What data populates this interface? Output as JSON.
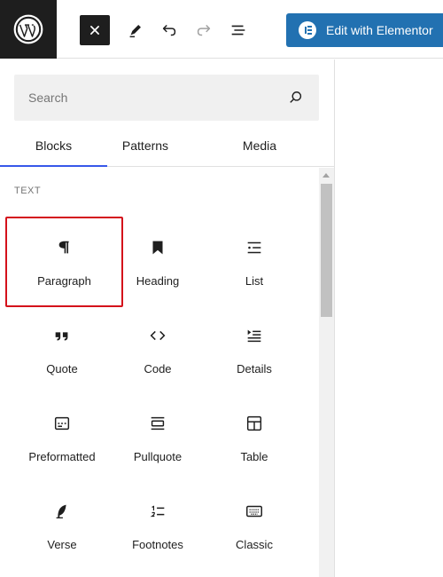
{
  "toolbar": {
    "wordpress_logo": "wordpress-logo",
    "close_icon": "close-icon",
    "tools_icon": "pencil-icon",
    "undo_icon": "undo-icon",
    "redo_icon": "redo-icon",
    "outline_icon": "list-view-icon",
    "elementor_label": "Edit with Elementor"
  },
  "inserter": {
    "search": {
      "placeholder": "Search",
      "value": ""
    },
    "tabs": [
      {
        "label": "Blocks",
        "active": true
      },
      {
        "label": "Patterns",
        "active": false
      },
      {
        "label": "Media",
        "active": false
      }
    ],
    "section_title": "TEXT",
    "blocks": [
      {
        "label": "Paragraph",
        "icon": "paragraph-icon",
        "selected": true
      },
      {
        "label": "Heading",
        "icon": "heading-icon",
        "selected": false
      },
      {
        "label": "List",
        "icon": "list-icon",
        "selected": false
      },
      {
        "label": "Quote",
        "icon": "quote-icon",
        "selected": false
      },
      {
        "label": "Code",
        "icon": "code-icon",
        "selected": false
      },
      {
        "label": "Details",
        "icon": "details-icon",
        "selected": false
      },
      {
        "label": "Preformatted",
        "icon": "preformatted-icon",
        "selected": false
      },
      {
        "label": "Pullquote",
        "icon": "pullquote-icon",
        "selected": false
      },
      {
        "label": "Table",
        "icon": "table-icon",
        "selected": false
      },
      {
        "label": "Verse",
        "icon": "verse-icon",
        "selected": false
      },
      {
        "label": "Footnotes",
        "icon": "footnotes-icon",
        "selected": false
      },
      {
        "label": "Classic",
        "icon": "classic-icon",
        "selected": false
      }
    ]
  },
  "colors": {
    "accent": "#3858e9",
    "elementor_blue": "#2271b1",
    "selection_outline": "#d4111b",
    "dark": "#1e1e1e"
  }
}
